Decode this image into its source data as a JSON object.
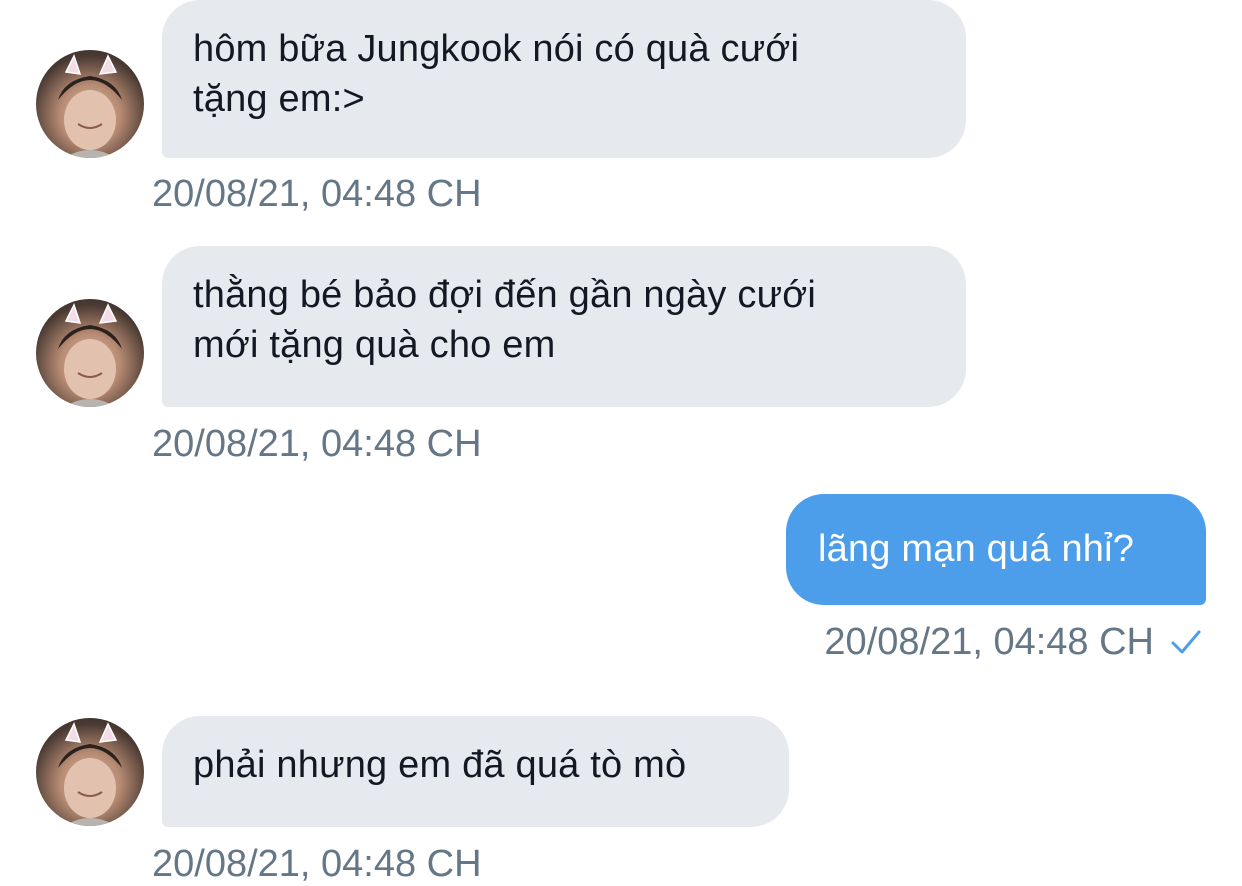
{
  "messages": [
    {
      "direction": "incoming",
      "text": "hôm bữa Jungkook nói có quà cưới\ntặng em:>",
      "timestamp": "20/08/21, 04:48 CH"
    },
    {
      "direction": "incoming",
      "text": "thằng bé bảo đợi đến gần ngày cưới\nmới tặng quà cho em",
      "timestamp": "20/08/21, 04:48 CH"
    },
    {
      "direction": "outgoing",
      "text": "lãng mạn quá nhỉ?",
      "timestamp": "20/08/21, 04:48 CH",
      "status_icon": "check-icon"
    },
    {
      "direction": "incoming",
      "text": "phải nhưng em đã quá tò mò",
      "timestamp": "20/08/21, 04:48 CH"
    }
  ],
  "colors": {
    "incoming_bubble": "#e6e9ee",
    "outgoing_bubble": "#4c9eeb",
    "timestamp": "#657786",
    "check": "#4c9eeb"
  }
}
